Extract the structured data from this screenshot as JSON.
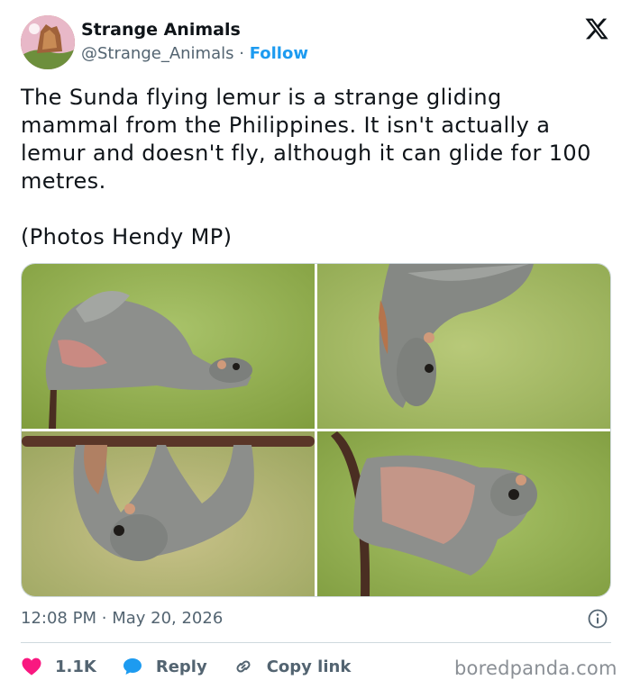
{
  "author": {
    "name": "Strange Animals",
    "handle": "@Strange_Animals",
    "separator": "·",
    "follow_label": "Follow"
  },
  "tweet": {
    "text": "The Sunda flying lemur is a strange gliding\nmammal from the Philippines. It isn't actually a\nlemur and doesn't fly, although it can glide for 100\nmetres.",
    "credit": "(Photos Hendy MP)"
  },
  "media": {
    "photos": [
      {
        "subject": "flying lemur clinging to branch"
      },
      {
        "subject": "flying lemur hanging upside down"
      },
      {
        "subject": "flying lemur hanging from bar"
      },
      {
        "subject": "flying lemur with patagium spread"
      }
    ]
  },
  "meta": {
    "time": "12:08 PM",
    "separator": "·",
    "date": "May 20, 2026"
  },
  "actions": {
    "likes_count": "1.1K",
    "reply_label": "Reply",
    "copy_link_label": "Copy link"
  },
  "watermark": "boredpanda.com",
  "colors": {
    "accent": "#1d9bf0",
    "like": "#f91880",
    "text": "#0f1419",
    "muted": "#536471"
  },
  "icons": [
    "x-logo-icon",
    "info-icon",
    "heart-icon",
    "reply-bubble-icon",
    "link-icon"
  ]
}
